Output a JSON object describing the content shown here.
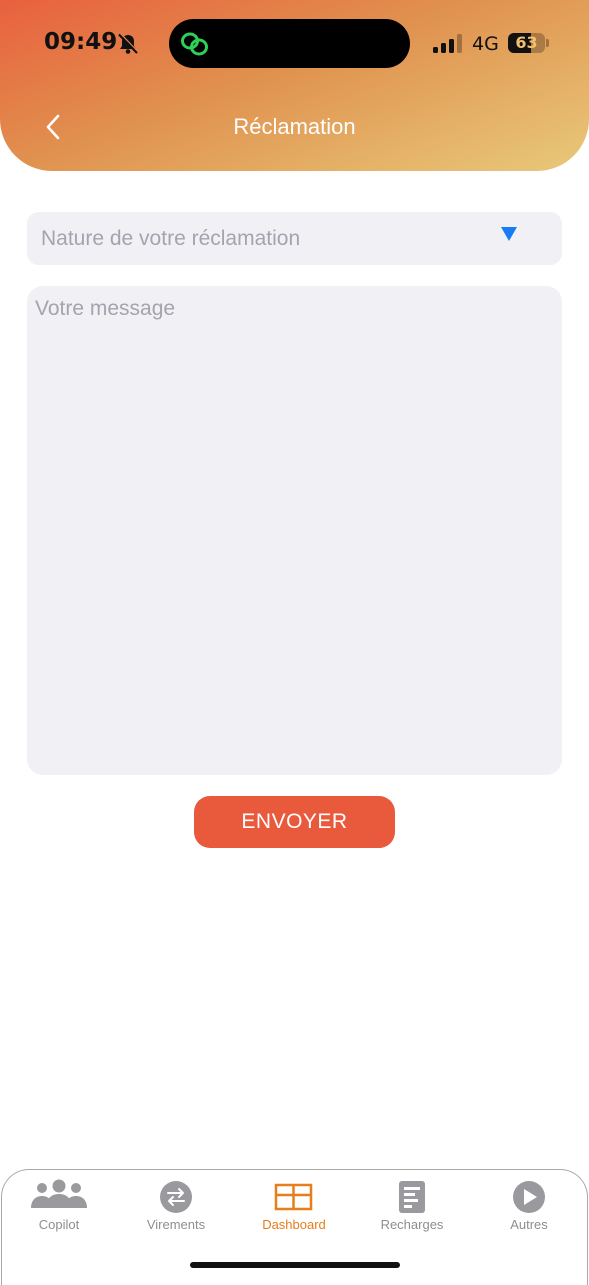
{
  "status_bar": {
    "time": "09:49",
    "network": "4G",
    "battery_percent": 63,
    "battery_label": "63"
  },
  "header": {
    "title": "Réclamation"
  },
  "form": {
    "nature_placeholder": "Nature de votre réclamation",
    "message_placeholder": "Votre message",
    "submit_label": "ENVOYER"
  },
  "tabbar": {
    "tabs": [
      {
        "label": "Copilot",
        "icon": "people-icon",
        "active": false
      },
      {
        "label": "Virements",
        "icon": "transfer-icon",
        "active": false
      },
      {
        "label": "Dashboard",
        "icon": "grid-icon",
        "active": true
      },
      {
        "label": "Recharges",
        "icon": "document-icon",
        "active": false
      },
      {
        "label": "Autres",
        "icon": "play-icon",
        "active": false
      }
    ]
  },
  "colors": {
    "accent": "#e95a3c",
    "active_tab": "#e77d1b",
    "dropdown_arrow": "#1a7cf5",
    "field_bg": "#f0f0f5"
  }
}
